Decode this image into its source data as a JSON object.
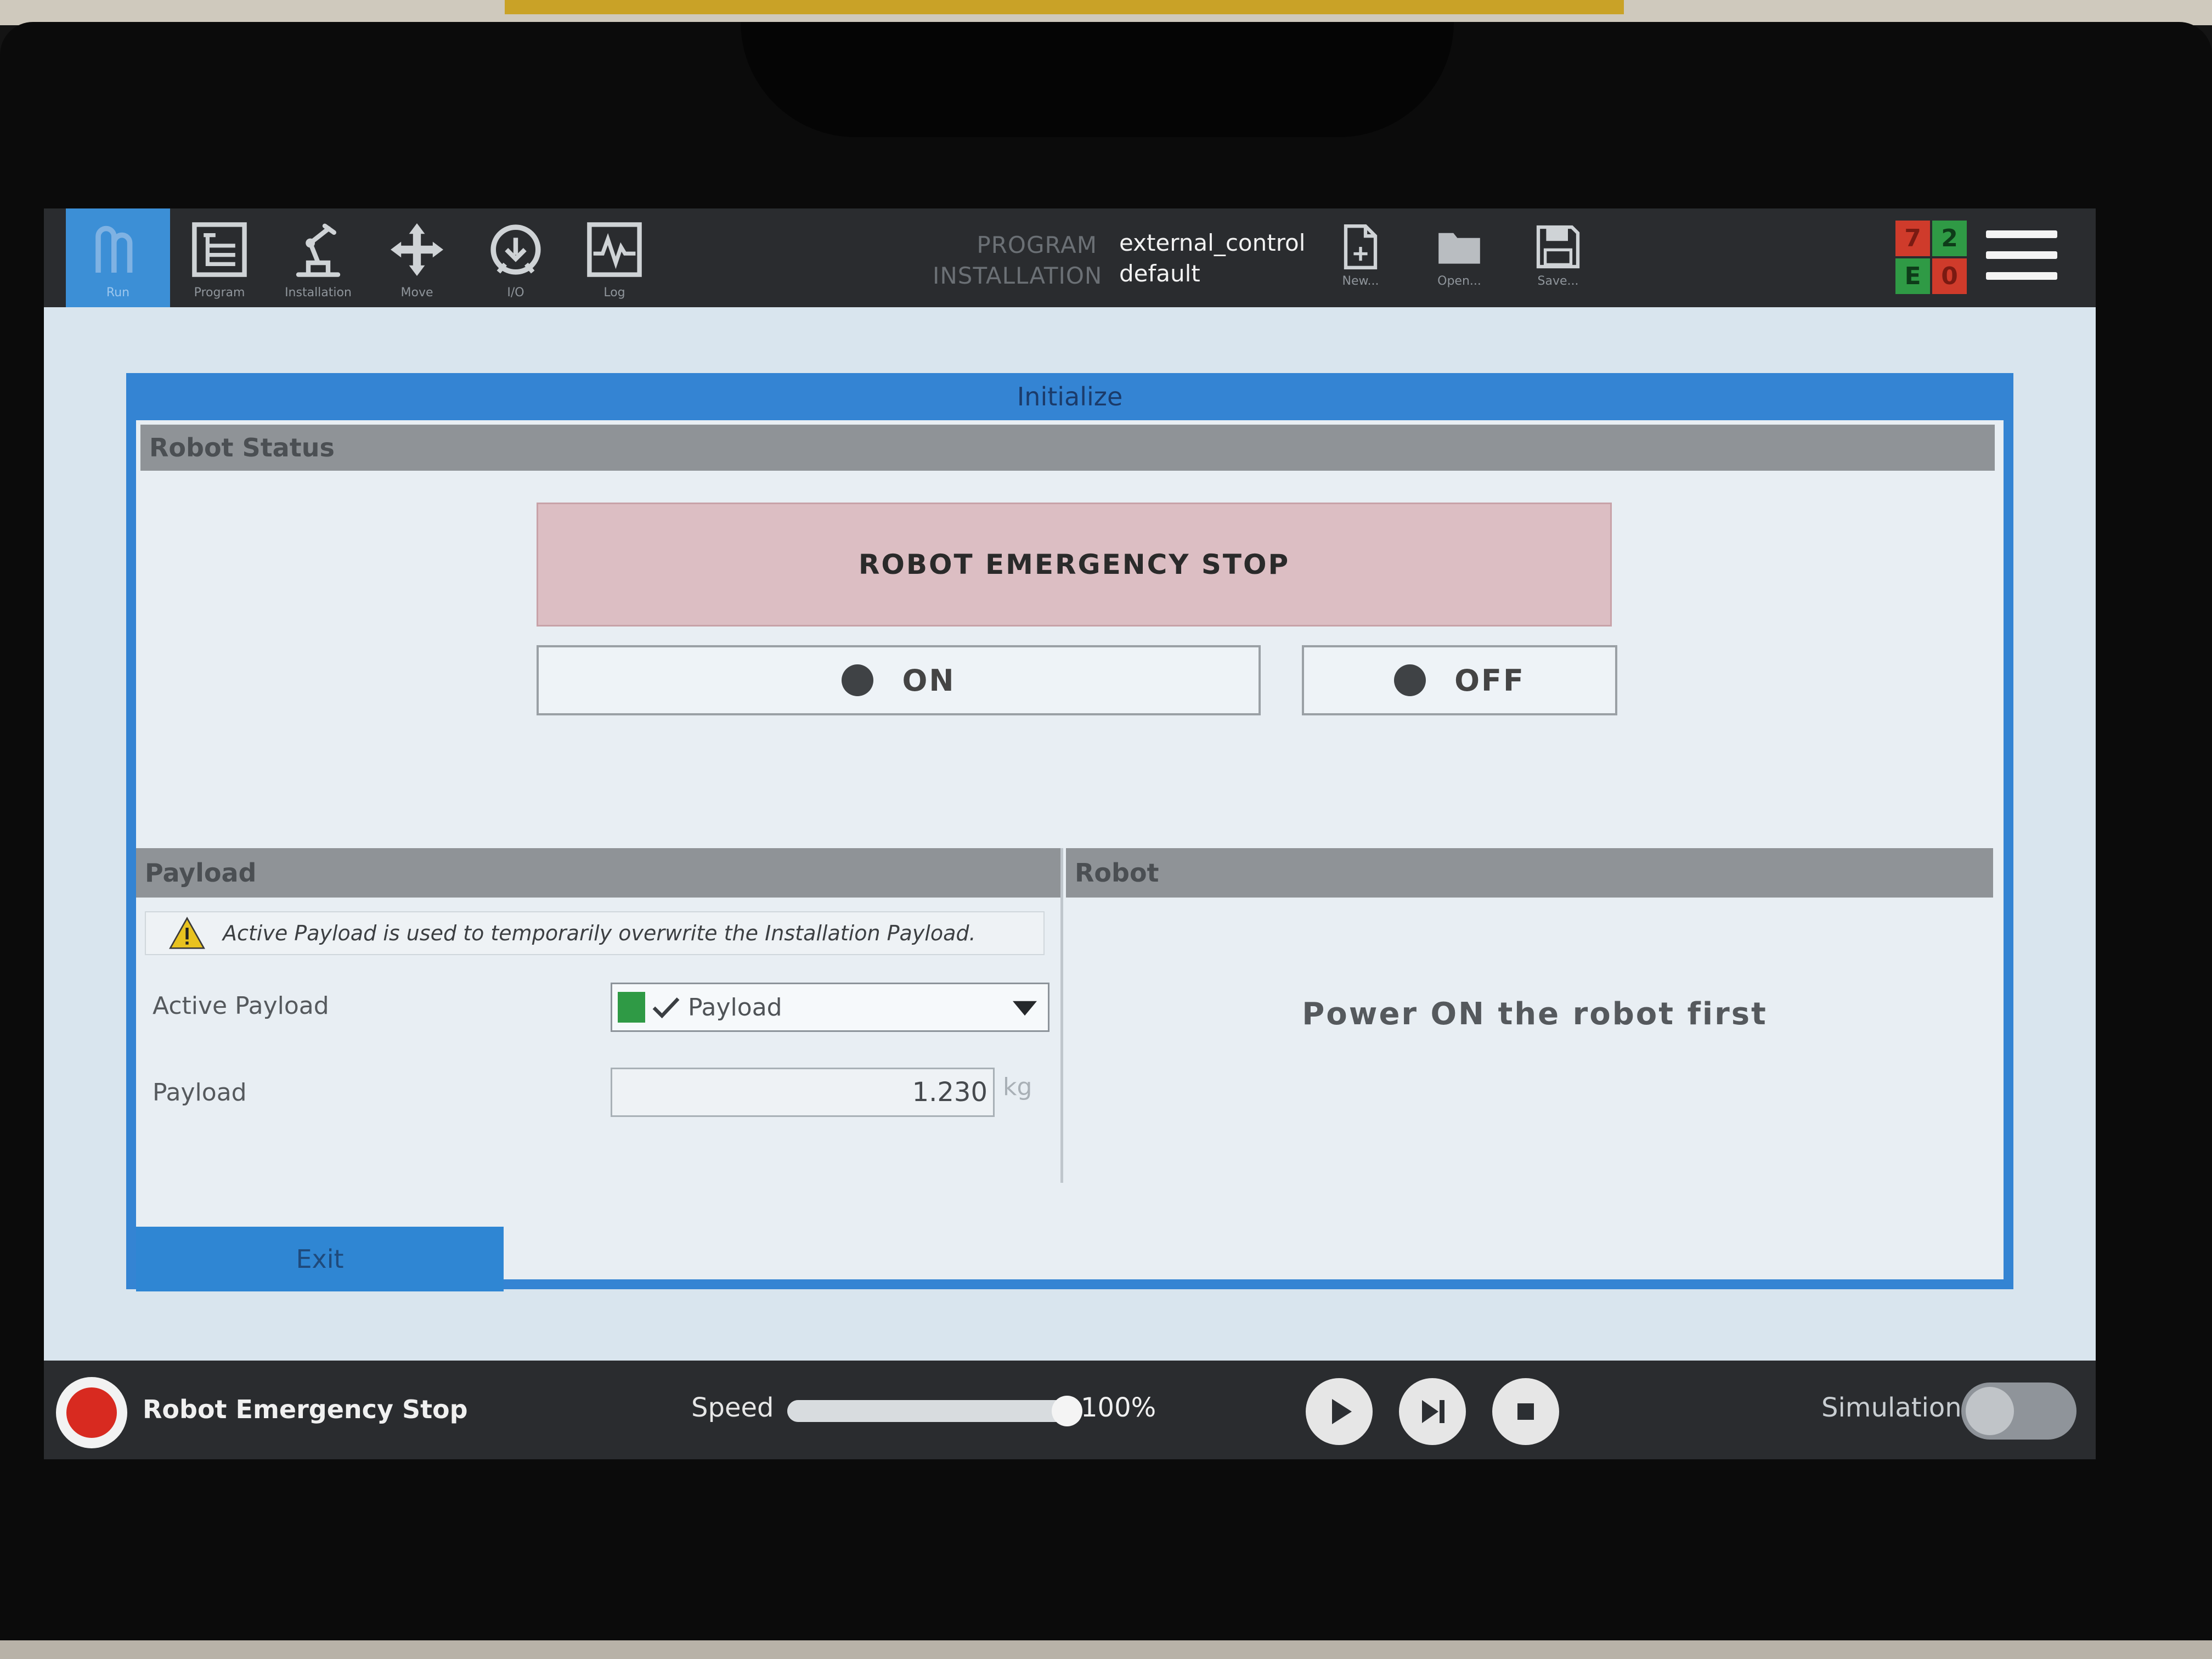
{
  "header": {
    "nav": [
      {
        "label": "Run",
        "icon": "run-icon"
      },
      {
        "label": "Program",
        "icon": "program-icon"
      },
      {
        "label": "Installation",
        "icon": "installation-icon"
      },
      {
        "label": "Move",
        "icon": "move-icon"
      },
      {
        "label": "I/O",
        "icon": "io-icon"
      },
      {
        "label": "Log",
        "icon": "log-icon"
      }
    ],
    "program_key": "PROGRAM",
    "program_value": "external_control",
    "installation_key": "INSTALLATION",
    "installation_value": "default",
    "file_buttons": [
      {
        "label": "New...",
        "icon": "new-file-icon"
      },
      {
        "label": "Open...",
        "icon": "open-folder-icon"
      },
      {
        "label": "Save...",
        "icon": "save-icon"
      }
    ],
    "status_grid": [
      "7",
      "2",
      "E",
      "0"
    ],
    "menu_icon": "hamburger-menu-icon"
  },
  "dialog": {
    "title": "Initialize",
    "robot_status_header": "Robot Status",
    "estop_banner": "ROBOT EMERGENCY STOP",
    "on_label": "ON",
    "off_label": "OFF",
    "payload_header": "Payload",
    "payload_note": "Active Payload is used to temporarily overwrite the Installation Payload.",
    "active_payload_label": "Active Payload",
    "active_payload_value": "Payload",
    "payload_label": "Payload",
    "payload_value": "1.230",
    "payload_unit": "kg",
    "robot_header": "Robot",
    "robot_message": "Power ON the robot first",
    "exit_label": "Exit"
  },
  "footer": {
    "status_text": "Robot Emergency Stop",
    "speed_label": "Speed",
    "speed_value": "100%",
    "speed_level": 1.0,
    "simulation_label": "Simulation",
    "simulation_on": false
  },
  "colors": {
    "accent_blue": "#3484d3",
    "estop_red": "#d82a20",
    "estop_banner": "#dcbec3",
    "status_ok_green": "#2f9a45"
  }
}
